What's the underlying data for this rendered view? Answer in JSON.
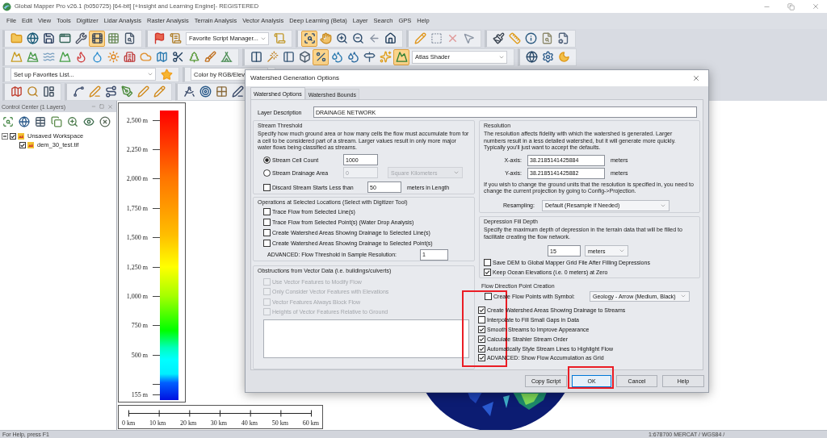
{
  "window": {
    "title": "Global Mapper Pro v26.1 (b050725) [64-bit] [+Insight and Learning Engine]- REGISTERED"
  },
  "menu": [
    "File",
    "Edit",
    "View",
    "Tools",
    "Digitizer",
    "Lidar Analysis",
    "Raster Analysis",
    "Terrain Analysis",
    "Vector Analysis",
    "Deep Learning (Beta)",
    "Layer",
    "Search",
    "GPS",
    "Help"
  ],
  "toolbars": [
    {
      "bands": [
        {
          "items": [
            {
              "kind": "button",
              "pressed": false
            },
            {
              "kind": "button",
              "pressed": false
            },
            {
              "kind": "button",
              "pressed": false
            },
            {
              "kind": "button",
              "pressed": false
            },
            {
              "kind": "button",
              "pressed": false
            },
            {
              "kind": "button",
              "pressed": true
            },
            {
              "kind": "button",
              "pressed": false
            },
            {
              "kind": "button",
              "pressed": false
            }
          ]
        },
        {
          "items": [
            {
              "kind": "button",
              "pressed": false
            },
            {
              "kind": "button",
              "pressed": false
            },
            {
              "kind": "combo",
              "value": "Favorite Script Manager..."
            },
            {
              "kind": "button",
              "pressed": false
            }
          ]
        },
        {
          "items": [
            {
              "kind": "button",
              "pressed": true
            },
            {
              "kind": "button",
              "pressed": false
            },
            {
              "kind": "button",
              "pressed": false
            },
            {
              "kind": "button",
              "pressed": false
            },
            {
              "kind": "button",
              "pressed": false
            },
            {
              "kind": "button",
              "pressed": false
            }
          ]
        },
        {
          "items": [
            {
              "kind": "button",
              "pressed": false
            },
            {
              "kind": "button",
              "pressed": false
            },
            {
              "kind": "button",
              "pressed": false
            },
            {
              "kind": "button",
              "pressed": false
            }
          ]
        },
        {
          "items": [
            {
              "kind": "button",
              "pressed": false
            },
            {
              "kind": "button",
              "pressed": false
            },
            {
              "kind": "button",
              "pressed": false
            },
            {
              "kind": "button",
              "pressed": false
            },
            {
              "kind": "button",
              "pressed": false
            }
          ]
        }
      ]
    },
    {
      "bands": [
        {
          "items": [
            {
              "kind": "button",
              "pressed": false
            },
            {
              "kind": "button",
              "pressed": false
            },
            {
              "kind": "button",
              "pressed": false
            },
            {
              "kind": "button",
              "pressed": false
            },
            {
              "kind": "button",
              "pressed": false
            },
            {
              "kind": "button",
              "pressed": false
            },
            {
              "kind": "button",
              "pressed": false
            },
            {
              "kind": "button",
              "pressed": false
            },
            {
              "kind": "button",
              "pressed": false
            },
            {
              "kind": "button",
              "pressed": false
            },
            {
              "kind": "button",
              "pressed": false
            },
            {
              "kind": "button",
              "pressed": false
            },
            {
              "kind": "button",
              "pressed": false
            },
            {
              "kind": "button",
              "pressed": false
            }
          ]
        },
        {
          "items": [
            {
              "kind": "button",
              "pressed": false
            },
            {
              "kind": "button",
              "pressed": false
            },
            {
              "kind": "button",
              "pressed": false
            },
            {
              "kind": "button",
              "pressed": false
            },
            {
              "kind": "button",
              "pressed": true
            },
            {
              "kind": "button",
              "pressed": false
            },
            {
              "kind": "button",
              "pressed": false
            },
            {
              "kind": "button",
              "pressed": false
            },
            {
              "kind": "button",
              "pressed": false
            },
            {
              "kind": "button",
              "pressed": true
            },
            {
              "kind": "combo",
              "value": "Atlas Shader"
            }
          ]
        },
        {
          "items": [
            {
              "kind": "button",
              "pressed": false
            },
            {
              "kind": "button",
              "pressed": false
            },
            {
              "kind": "button",
              "pressed": false
            }
          ]
        }
      ]
    },
    {
      "bands": [
        {
          "items": [
            {
              "kind": "combo",
              "value": "Set up Favorites List..."
            },
            {
              "kind": "button",
              "pressed": false
            }
          ]
        },
        {
          "items": [
            {
              "kind": "combo",
              "value": "Color by RGB/Elev"
            }
          ]
        }
      ]
    },
    {
      "bands": [
        {
          "items": [
            {
              "kind": "button",
              "pressed": false
            },
            {
              "kind": "button",
              "pressed": false
            },
            {
              "kind": "button",
              "pressed": false
            }
          ]
        },
        {
          "items": [
            {
              "kind": "button",
              "pressed": false
            },
            {
              "kind": "button",
              "pressed": false
            },
            {
              "kind": "button",
              "pressed": false
            },
            {
              "kind": "button",
              "pressed": false
            },
            {
              "kind": "button",
              "pressed": false
            },
            {
              "kind": "button",
              "pressed": false
            }
          ]
        },
        {
          "items": [
            {
              "kind": "button",
              "pressed": false
            },
            {
              "kind": "button",
              "pressed": false
            },
            {
              "kind": "button",
              "pressed": false
            },
            {
              "kind": "button",
              "pressed": false
            }
          ]
        }
      ]
    }
  ],
  "control_center": {
    "title": "Control Center (1 Layers)",
    "tree": [
      {
        "label": "Unsaved Workspace",
        "checked": true,
        "expanded": true,
        "children": [
          {
            "label": "dem_30_test.tif",
            "checked": true
          }
        ]
      }
    ]
  },
  "legend": {
    "labels": [
      "2,500 m",
      "2,250 m",
      "2,000 m",
      "1,750 m",
      "1,500 m",
      "1,250 m",
      "1,000 m",
      "750 m",
      "500 m",
      "155 m"
    ]
  },
  "scale_bar": {
    "labels": [
      "0 km",
      "10 km",
      "20 km",
      "30 km",
      "40 km",
      "50 km",
      "60 km"
    ]
  },
  "dialog": {
    "title": "Watershed Generation Options",
    "tabs": [
      {
        "label": "Watershed Options",
        "selected": true
      },
      {
        "label": "Watershed Bounds",
        "selected": false
      }
    ],
    "layer_description": {
      "label": "Layer Description",
      "value": "DRAINAGE NETWORK"
    },
    "stream_threshold": {
      "title": "Stream Threshold",
      "description": "Specify how much ground area or how many cells the flow must accumulate from for a cell to be considered part of a stream. Larger values result in only more major water flows being classified as streams.",
      "options": [
        {
          "label": "Stream Cell Count",
          "selected": true,
          "value": "1000",
          "disabled": false
        },
        {
          "label": "Stream Drainage Area",
          "selected": false,
          "value": "0",
          "disabled": true,
          "unit": "Square Kilometers"
        }
      ],
      "discard": {
        "label": "Discard Stream Starts Less than",
        "checked": false,
        "value": "50",
        "unit": "meters in Length"
      }
    },
    "operations": {
      "title": "Operations at Selected Locations (Select with Digitizer Tool)",
      "checkboxes": [
        {
          "label": "Trace Flow from Selected Line(s)",
          "checked": false
        },
        {
          "label": "Trace Flow from Selected Point(s) (Water Drop Analysis)",
          "checked": false
        },
        {
          "label": "Create Watershed Areas Showing Drainage to Selected Line(s)",
          "checked": false
        },
        {
          "label": "Create Watershed Areas Showing Drainage to Selected Point(s)",
          "checked": false
        }
      ],
      "advanced": {
        "label": "ADVANCED: Flow Threshold in Sample Resolution:",
        "value": "1"
      }
    },
    "obstructions": {
      "title": "Obstructions from Vector Data (i.e. buildings/culverts)",
      "checkboxes": [
        {
          "label": "Use Vector Features to Modify Flow",
          "checked": false,
          "disabled": true
        },
        {
          "label": "Only Consider Vector Features with Elevations",
          "checked": false,
          "disabled": true
        },
        {
          "label": "Vector Features Always Block Flow",
          "checked": false,
          "disabled": true
        },
        {
          "label": "Heights of Vector Features Relative to Ground",
          "checked": false,
          "disabled": true
        }
      ]
    },
    "resolution": {
      "title": "Resolution",
      "description": "The resolution affects fidelity with which the watershed is generated. Larger numbers result in a less detailed watershed, but it will generate more quickly. Typically you'll just want to accept the defaults.",
      "axes": [
        {
          "label": "X-axis:",
          "value": "38.2185141425884",
          "unit": "meters"
        },
        {
          "label": "Y-axis:",
          "value": "38.2185141425882",
          "unit": "meters"
        }
      ],
      "note": "If you wish to change the ground units that the resolution is specified in, you need to change the current projection by going to Config->Projection.",
      "resampling": {
        "label": "Resampling:",
        "value": "Default (Resample if Needed)"
      }
    },
    "depression_fill": {
      "title": "Depression Fill Depth",
      "description": "Specify the maximum depth of depression in the terrain data that will be filled to facilitate creating the flow network.",
      "value": "15",
      "unit": "meters",
      "checkboxes": [
        {
          "label": "Save DEM to Global Mapper Grid File After Filling Depressions",
          "checked": false
        },
        {
          "label": "Keep Ocean Elevations (i.e. 0 meters) at Zero",
          "checked": true
        }
      ]
    },
    "flow_direction": {
      "title": "Flow Direction Point Creation",
      "create_points": {
        "label": "Create Flow Points with Symbol:",
        "checked": false,
        "symbol": "Geology - Arrow (Medium, Black)"
      },
      "highlighted": true,
      "checkboxes": [
        {
          "label": "Create Watershed Areas Showing Drainage to Streams",
          "checked": true
        },
        {
          "label": "Interpolate to Fill Small Gaps in Data",
          "checked": false
        },
        {
          "label": "Smooth Streams to Improve Appearance",
          "checked": true
        },
        {
          "label": "Calculate Strahler Stream Order",
          "checked": true
        },
        {
          "label": "Automatically Style Stream Lines to Highlight Flow",
          "checked": true
        },
        {
          "label": "ADVANCED: Show Flow Accumulation as Grid",
          "checked": true
        }
      ]
    },
    "buttons": [
      {
        "label": "Copy Script",
        "default": false,
        "highlighted": false
      },
      {
        "label": "OK",
        "default": true,
        "highlighted": true
      },
      {
        "label": "Cancel",
        "default": false,
        "highlighted": false
      },
      {
        "label": "Help",
        "default": false,
        "highlighted": false
      }
    ]
  },
  "status_bar": {
    "help": "For Help, press F1",
    "coordinates": "1:678700 MERCAT / WGS84 /"
  }
}
